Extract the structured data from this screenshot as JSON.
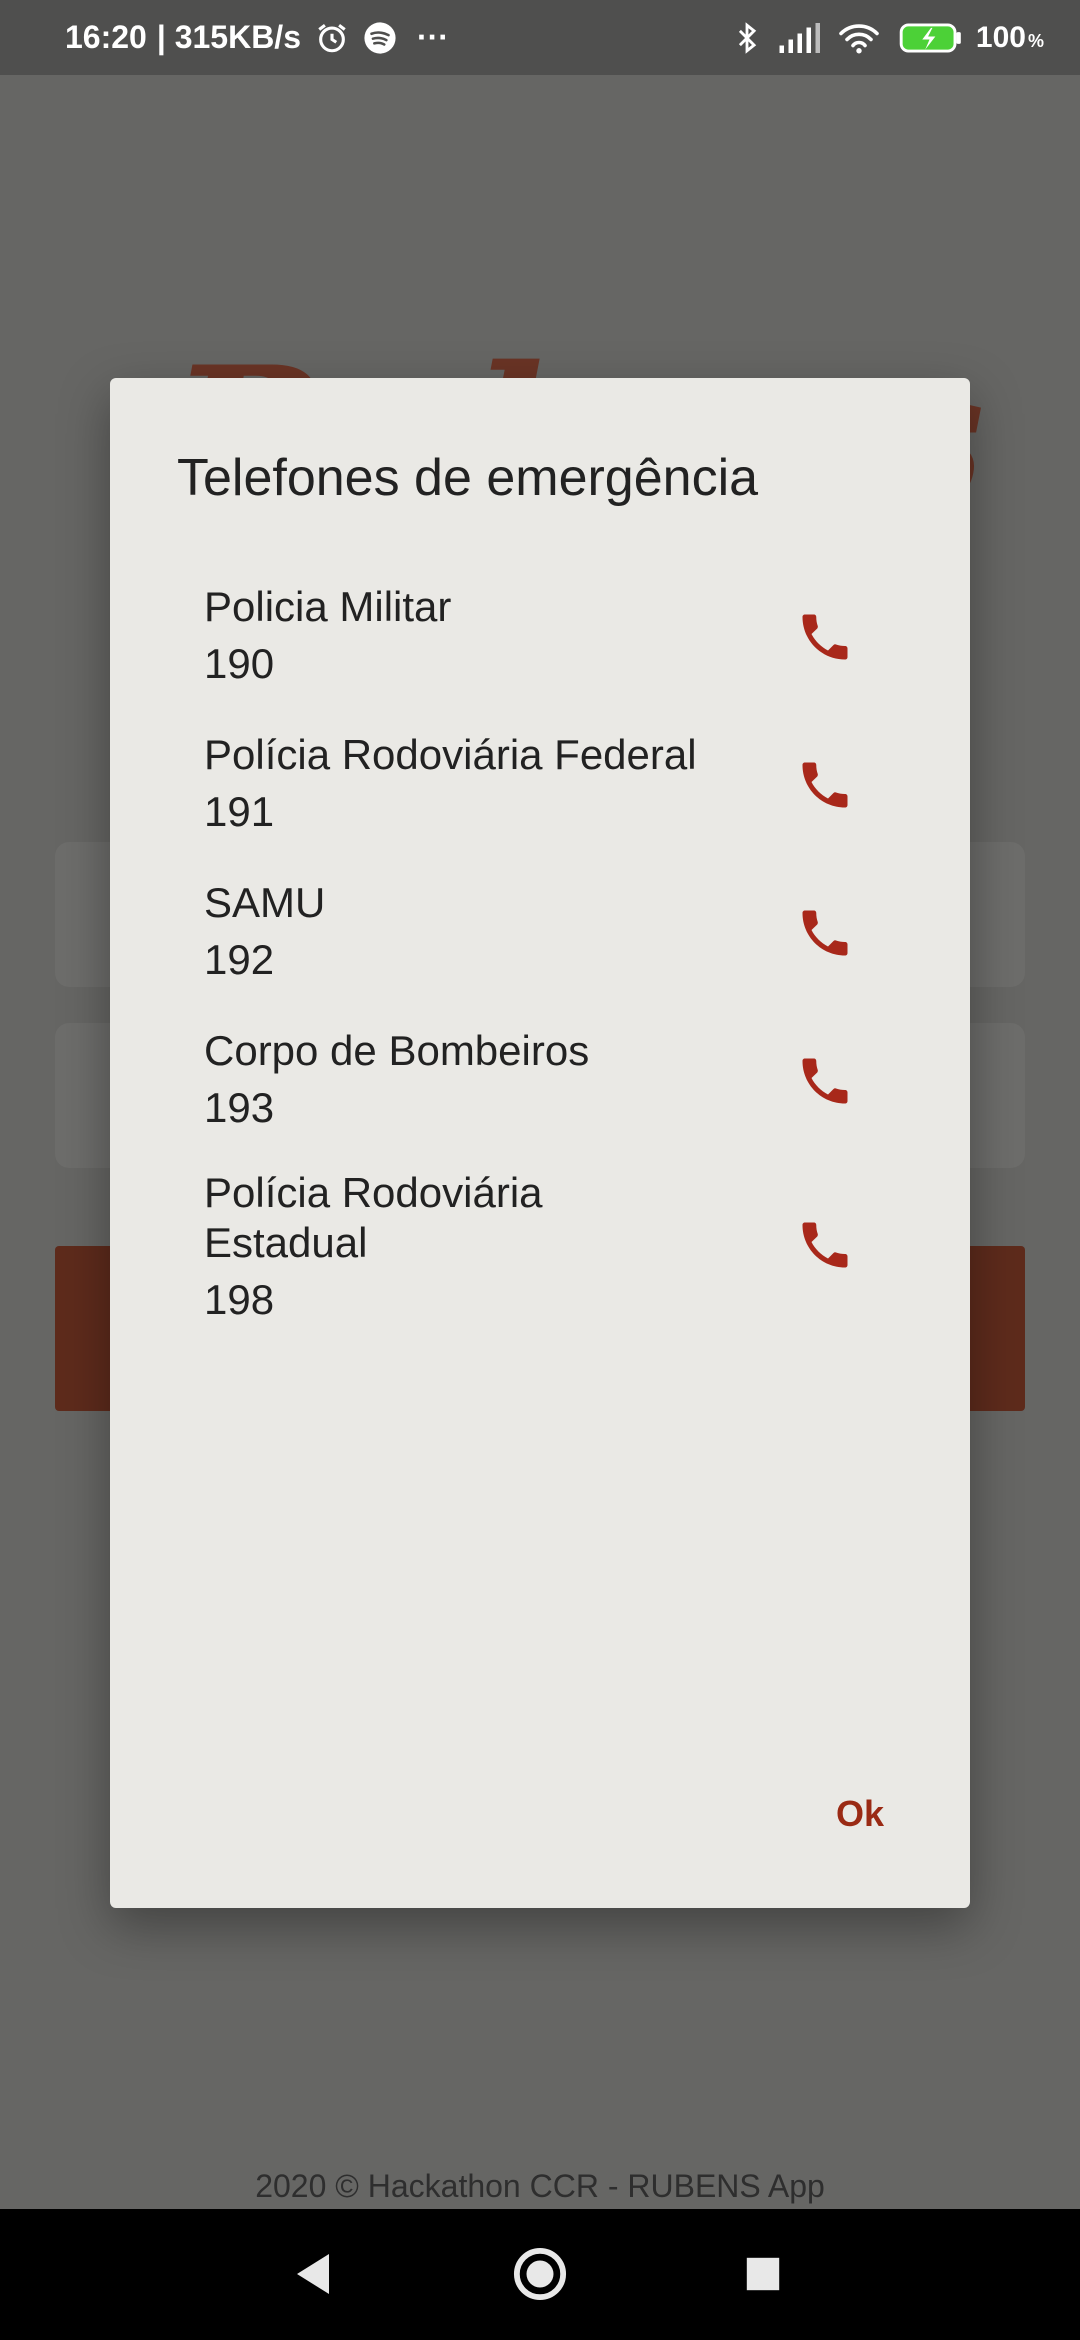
{
  "status_bar": {
    "time": "16:20",
    "network_speed": "| 315KB/s",
    "more": "···",
    "battery": "100",
    "battery_unit": "%",
    "icons": [
      "alarm-icon",
      "spotify-icon",
      "bluetooth-icon",
      "signal-icon",
      "wifi-icon",
      "battery-charging-icon"
    ]
  },
  "background": {
    "logo_text": "Rubens",
    "footer": "2020 © Hackathon CCR - RUBENS App",
    "accent_color": "#5e2b1c"
  },
  "dialog": {
    "title": "Telefones de emergência",
    "contacts": [
      {
        "name": "Policia Militar",
        "number": "190"
      },
      {
        "name": "Polícia Rodoviária Federal",
        "number": "191"
      },
      {
        "name": "SAMU",
        "number": "192"
      },
      {
        "name": "Corpo de Bombeiros",
        "number": "193"
      },
      {
        "name": "Polícia Rodoviária Estadual",
        "number": "198"
      }
    ],
    "call_icon": "phone-icon",
    "icon_color": "#a8281a",
    "ok_label": "Ok"
  },
  "nav_bar": {
    "icons": [
      "back-icon",
      "home-icon",
      "recents-icon"
    ]
  }
}
